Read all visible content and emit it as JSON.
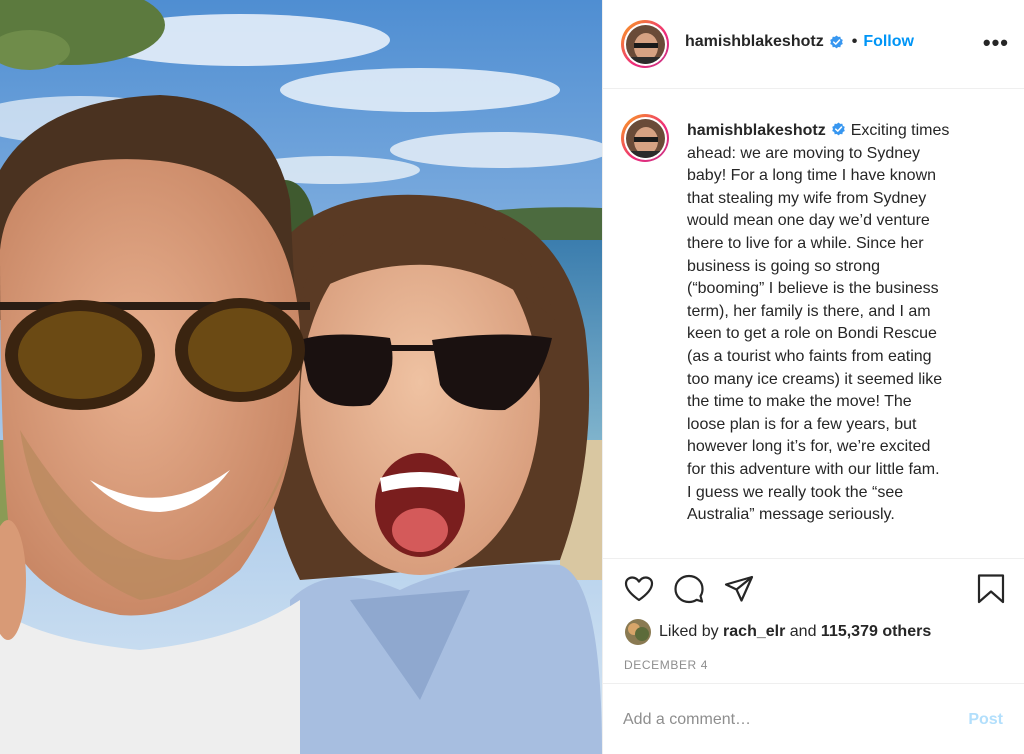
{
  "post": {
    "author": "hamishblakeshotz",
    "verified": true,
    "follow_label": "Follow",
    "separator": "•",
    "more_label": "•••",
    "caption_lines": [
      "Exciting times",
      "ahead: we are moving to Sydney",
      "baby! For a long time I have known",
      "that stealing my wife from Sydney",
      "would mean one day we’d venture",
      "there to live for a while. Since her",
      "business is going so strong",
      "(“booming” I believe is the business",
      "term), her family is there, and I am",
      "keen to get a role on Bondi Rescue",
      "(as a tourist who faints from eating",
      "too many ice creams) it seemed like",
      "the time to make the move! The",
      "loose plan is for a few years, but",
      "however long it’s for, we’re excited",
      "for this adventure with our little fam.",
      "I guess we really took the “see",
      "Australia” message seriously."
    ],
    "likes": {
      "prefix": "Liked by",
      "user": "rach_elr",
      "joiner": "and",
      "count_text": "115,379 others"
    },
    "date": "DECEMBER 4"
  },
  "comment": {
    "placeholder": "Add a comment…",
    "post_label": "Post"
  },
  "icons": [
    "heart-icon",
    "comment-icon",
    "share-icon",
    "bookmark-icon",
    "verified-badge-icon",
    "more-options-icon"
  ],
  "colors": {
    "link_blue": "#0095f6",
    "post_disabled": "#b2dffc",
    "text": "#262626",
    "muted": "#8e8e8e",
    "divider": "#efefef"
  }
}
